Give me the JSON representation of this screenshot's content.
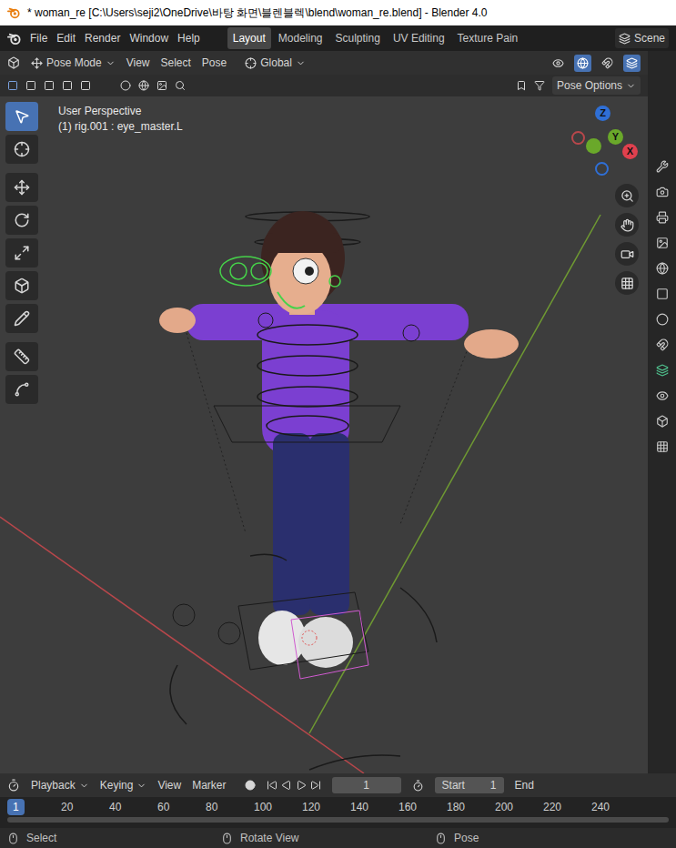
{
  "window": {
    "title": "* woman_re [C:\\Users\\seji2\\OneDrive\\바탕 화면\\블렌블렉\\blend\\woman_re.blend] - Blender 4.0"
  },
  "menu_bar": {
    "menus": [
      "File",
      "Edit",
      "Render",
      "Window",
      "Help"
    ],
    "workspaces": [
      {
        "label": "Layout",
        "selected": true
      },
      {
        "label": "Modeling",
        "selected": false
      },
      {
        "label": "Sculpting",
        "selected": false
      },
      {
        "label": "UV Editing",
        "selected": false
      },
      {
        "label": "Texture Pain",
        "selected": false
      }
    ],
    "scene": "Scene"
  },
  "header": {
    "mode": "Pose Mode",
    "menus": [
      "View",
      "Select",
      "Pose"
    ],
    "orientation": "Global",
    "view_toggles": [
      {
        "active": false
      },
      {
        "active": true
      },
      {
        "active": false
      },
      {
        "active": true
      }
    ]
  },
  "tool_settings": {
    "pose_options": "Pose Options"
  },
  "toolbar": {
    "tools": [
      {
        "kind": "select",
        "selected": true
      },
      {
        "kind": "cursor",
        "selected": false
      },
      {
        "kind": "move",
        "selected": false
      },
      {
        "kind": "rotate",
        "selected": false
      },
      {
        "kind": "scale",
        "selected": false
      },
      {
        "kind": "transform",
        "selected": false
      },
      {
        "kind": "annotate",
        "selected": false
      },
      {
        "kind": "measure",
        "selected": false
      },
      {
        "kind": "curve",
        "selected": false
      }
    ]
  },
  "viewport": {
    "view_name": "User Perspective",
    "active": "(1) rig.001 : eye_master.L",
    "gizmo_axes": [
      {
        "label": "Z",
        "color": "#2f6fd6"
      },
      {
        "label": "Y",
        "color": "#6aa82a"
      },
      {
        "label": "X",
        "color": "#e0404e"
      }
    ]
  },
  "timeline": {
    "menus": [
      {
        "label": "Playback",
        "dropdown": true
      },
      {
        "label": "Keying",
        "dropdown": true
      },
      {
        "label": "View",
        "dropdown": false
      },
      {
        "label": "Marker",
        "dropdown": false
      }
    ],
    "current_frame": "1",
    "start_label": "Start",
    "start": "1",
    "end_label": "End",
    "ticks": [
      {
        "label": "1",
        "selected": true
      },
      {
        "label": "20",
        "selected": false
      },
      {
        "label": "40",
        "selected": false
      },
      {
        "label": "60",
        "selected": false
      },
      {
        "label": "80",
        "selected": false
      },
      {
        "label": "100",
        "selected": false
      },
      {
        "label": "120",
        "selected": false
      },
      {
        "label": "140",
        "selected": false
      },
      {
        "label": "160",
        "selected": false
      },
      {
        "label": "180",
        "selected": false
      },
      {
        "label": "200",
        "selected": false
      },
      {
        "label": "220",
        "selected": false
      },
      {
        "label": "240",
        "selected": false
      }
    ]
  },
  "status_bar": [
    {
      "label": "Select"
    },
    {
      "label": "Rotate View"
    },
    {
      "label": "Pose"
    }
  ]
}
